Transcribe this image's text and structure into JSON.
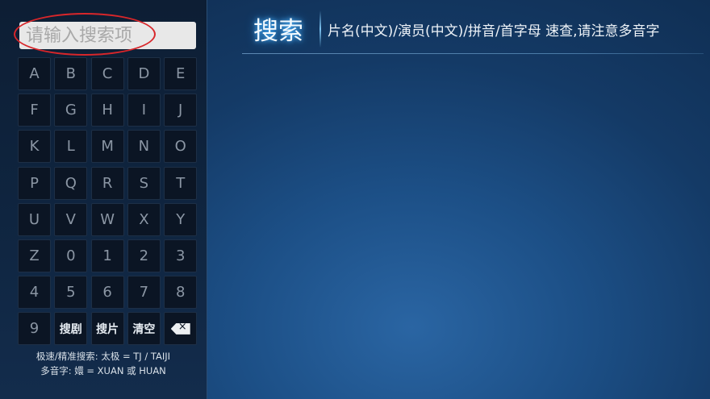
{
  "search": {
    "placeholder": "请输入搜索项",
    "value": ""
  },
  "keyboard": {
    "keys": [
      "A",
      "B",
      "C",
      "D",
      "E",
      "F",
      "G",
      "H",
      "I",
      "J",
      "K",
      "L",
      "M",
      "N",
      "O",
      "P",
      "Q",
      "R",
      "S",
      "T",
      "U",
      "V",
      "W",
      "X",
      "Y",
      "Z",
      "0",
      "1",
      "2",
      "3",
      "4",
      "5",
      "6",
      "7",
      "8",
      "9"
    ],
    "search_drama_label": "搜剧",
    "search_movie_label": "搜片",
    "clear_label": "清空",
    "backspace_icon": "backspace-icon"
  },
  "hints": {
    "line1": "极速/精准搜索: 太极 = TJ / TAIJI",
    "line2": "多音字: 嬛 = XUAN 或 HUAN"
  },
  "header": {
    "title": "搜索",
    "hint": "片名(中文)/演员(中文)/拼音/首字母 速查,请注意多音字"
  },
  "colors": {
    "annotation_ellipse": "#d8262a",
    "title_glow": "#4fb6ff",
    "key_background": "#0b1524"
  }
}
